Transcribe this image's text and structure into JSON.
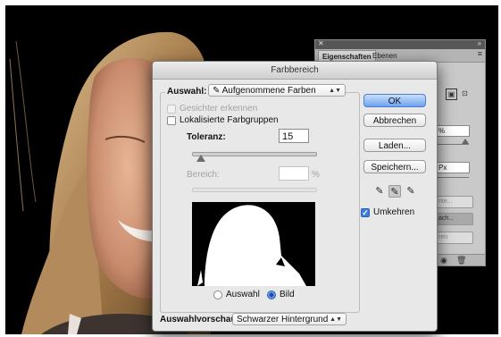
{
  "dialog": {
    "title": "Farbbereich",
    "auswahl_label": "Auswahl:",
    "auswahl_value": "Aufgenommene Farben",
    "gesichter_label": "Gesichter erkennen",
    "lokalisierte_label": "Lokalisierte Farbgruppen",
    "toleranz_label": "Toleranz:",
    "toleranz_value": "15",
    "toleranz_slider_fraction": 0.075,
    "bereich_label": "Bereich:",
    "bereich_value": "",
    "bereich_unit": "%",
    "radio_auswahl": "Auswahl",
    "radio_bild": "Bild",
    "auswahlvorschau_label": "Auswahlvorschau:",
    "auswahlvorschau_value": "Schwarzer Hintergrund",
    "buttons": {
      "ok": "OK",
      "abbrechen": "Abbrechen",
      "laden": "Laden...",
      "speichern": "Speichern..."
    },
    "umkehren_label": "Umkehren",
    "umkehren_checked": true,
    "selected_radio": "Bild"
  },
  "properties_panel": {
    "tabs": [
      "Eigenschaften",
      "Ebenen"
    ],
    "active_tab": "Eigenschaften",
    "field1_fragment": "%",
    "field2_fragment": "Px",
    "button1_fragment": "nte...",
    "button2_fragment": "ach...",
    "button3_fragment": "ren"
  },
  "colors": {
    "accent": "#4a86e0",
    "dialog_bg": "#e8e8e8",
    "canvas_bg": "#000000",
    "panel_bg": "#c9c9c9"
  }
}
